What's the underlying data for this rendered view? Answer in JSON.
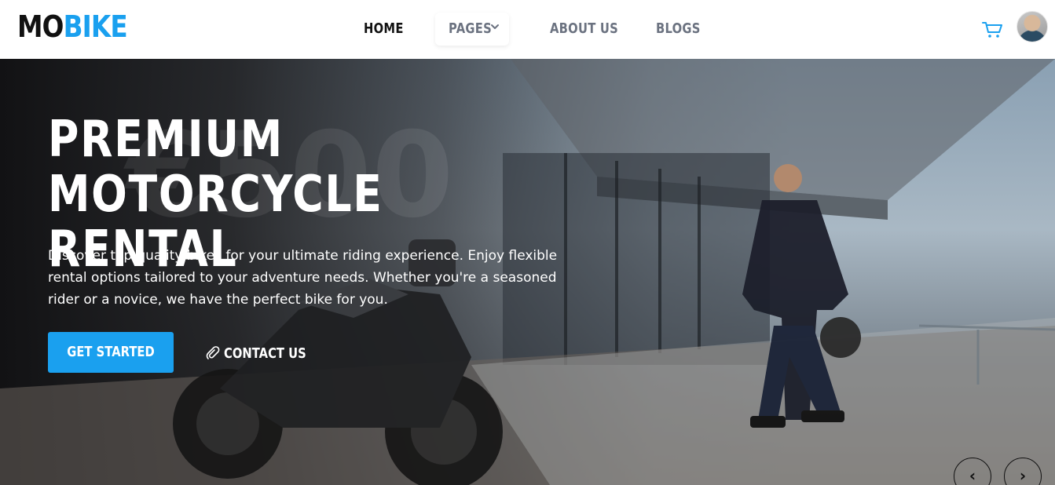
{
  "brand": {
    "part1": "MO",
    "part2": "BIKE"
  },
  "nav": {
    "home": "HOME",
    "pages": "PAGES",
    "about": "ABOUT US",
    "blogs": "BLOGS"
  },
  "icons": {
    "cart": "cart-icon",
    "avatar": "user-avatar",
    "pages_dropdown": "chevron-down-icon",
    "contact": "phone-icon",
    "prev": "chevron-left-icon",
    "next": "chevron-right-icon"
  },
  "hero": {
    "title": "PREMIUM MOTORCYCLE RENTAL",
    "description": "Discover top-quality bikes for your ultimate riding experience. Enjoy flexible rental options tailored to your adventure needs. Whether you're a seasoned rider or a novice, we have the perfect bike for you.",
    "primary_button": "GET STARTED",
    "secondary_button": "CONTACT US",
    "prev_arrow": "‹",
    "next_arrow": "›"
  },
  "colors": {
    "accent": "#1aa0ef",
    "text_dark": "#111111",
    "nav_inactive": "#6b7280"
  }
}
